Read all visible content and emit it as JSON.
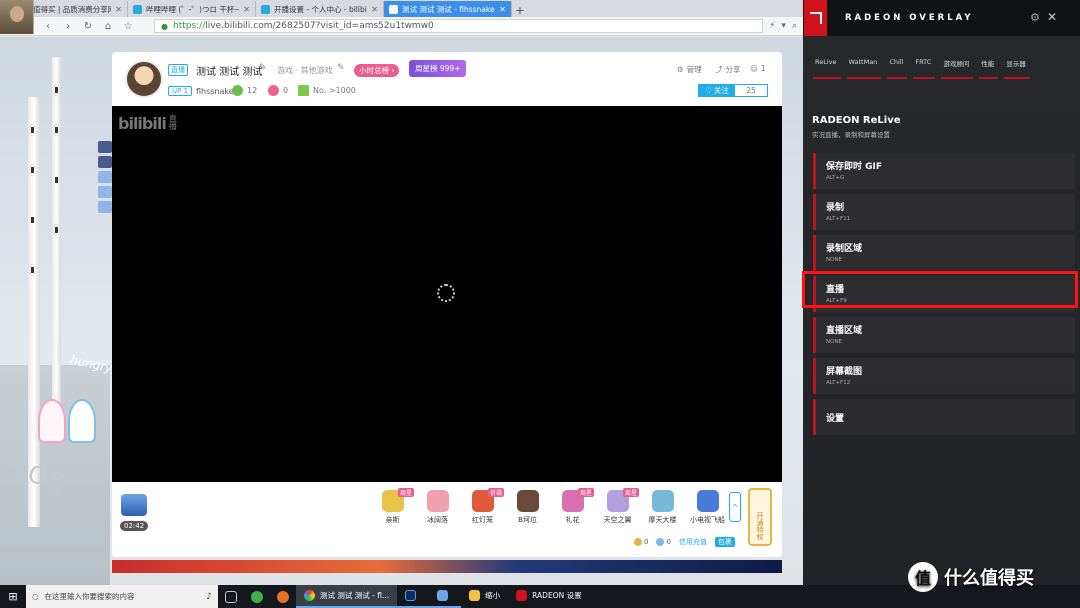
{
  "browser": {
    "tabs": [
      {
        "title": "什么值得买 | 品质消费分享网站",
        "color": "#e0434b",
        "active": false
      },
      {
        "title": "哔哩哔哩 (゜-゜)つロ 干杯~-bili",
        "color": "#23ade5",
        "active": false
      },
      {
        "title": "开播设置 - 个人中心 - bilibili 直",
        "color": "#23ade5",
        "active": false
      },
      {
        "title": "测试 测试 测试 - flhssnake - 哔",
        "color": "#ffffff",
        "active": true
      }
    ],
    "new_tab": "+",
    "url_scheme": "https://",
    "url_host": "live.bilibili.com",
    "url_path": "/2682507?visit_id=ams52u1twmw0"
  },
  "room": {
    "live_badge": "直播",
    "title": "测试 测试 测试",
    "area": "游戏 · 其他游戏",
    "hour_rank": "小时总榜 ›",
    "week_rank": "周星榜 999+",
    "up_badge": "UP 1",
    "uploader": "flhssnake",
    "level": "12",
    "gifts_count": "0",
    "rank": "No. >1000",
    "manage": "管理",
    "share": "分享",
    "viewers": "1",
    "follow": "关注",
    "follow_count": "25"
  },
  "player": {
    "logo": "bilibili",
    "logo_sub": "直播"
  },
  "giftbar": {
    "timer": "02:42",
    "gifts": [
      {
        "label": "亲斯",
        "tag": "周星",
        "color": "#e8c34a"
      },
      {
        "label": "冰阔落",
        "tag": "",
        "color": "#f0a0b0"
      },
      {
        "label": "红灯笼",
        "tag": "祈福",
        "color": "#e05a3a"
      },
      {
        "label": "B坷垃",
        "tag": "",
        "color": "#6a4a3a"
      },
      {
        "label": "礼花",
        "tag": "周星",
        "color": "#d870b0"
      },
      {
        "label": "天空之翼",
        "tag": "周星",
        "color": "#b0a0e0"
      },
      {
        "label": "摩天大楼",
        "tag": "",
        "color": "#7ab8d8"
      },
      {
        "label": "小电视飞船",
        "tag": "",
        "color": "#4a7ad8"
      }
    ],
    "scroll": "^",
    "vip": "开通特权",
    "gold": "0",
    "silver": "0",
    "link": "信用充值",
    "pack": "包裹"
  },
  "overlay": {
    "title": "RADEON OVERLAY",
    "tabs": [
      "ReLive",
      "WattMan",
      "Chill",
      "FRTC",
      "游戏顾问",
      "性能",
      "显示器"
    ],
    "section": "RADEON ReLive",
    "subtitle": "实况直播，录制和屏幕设置",
    "items": [
      {
        "name": "保存即时 GIF",
        "key": "ALT+G"
      },
      {
        "name": "录制",
        "key": "ALT+F11"
      },
      {
        "name": "录制区域",
        "key": "NONE"
      },
      {
        "name": "直播",
        "key": "ALT+F9"
      },
      {
        "name": "直播区域",
        "key": "NONE"
      },
      {
        "name": "屏幕截图",
        "key": "ALT+F12"
      }
    ],
    "settings": "设置",
    "accent": "#c0141c"
  },
  "taskbar": {
    "search": "在这里输入你要搜索的内容",
    "apps": [
      {
        "label": "测试 测试 测试 - fl...",
        "active": true
      },
      {
        "label": "",
        "active": false
      },
      {
        "label": "",
        "active": false
      },
      {
        "label": "缩小",
        "active": false
      },
      {
        "label": "RADEON 设置",
        "active": false
      }
    ]
  },
  "watermark": "什么值得买",
  "watermark_logo": "值"
}
